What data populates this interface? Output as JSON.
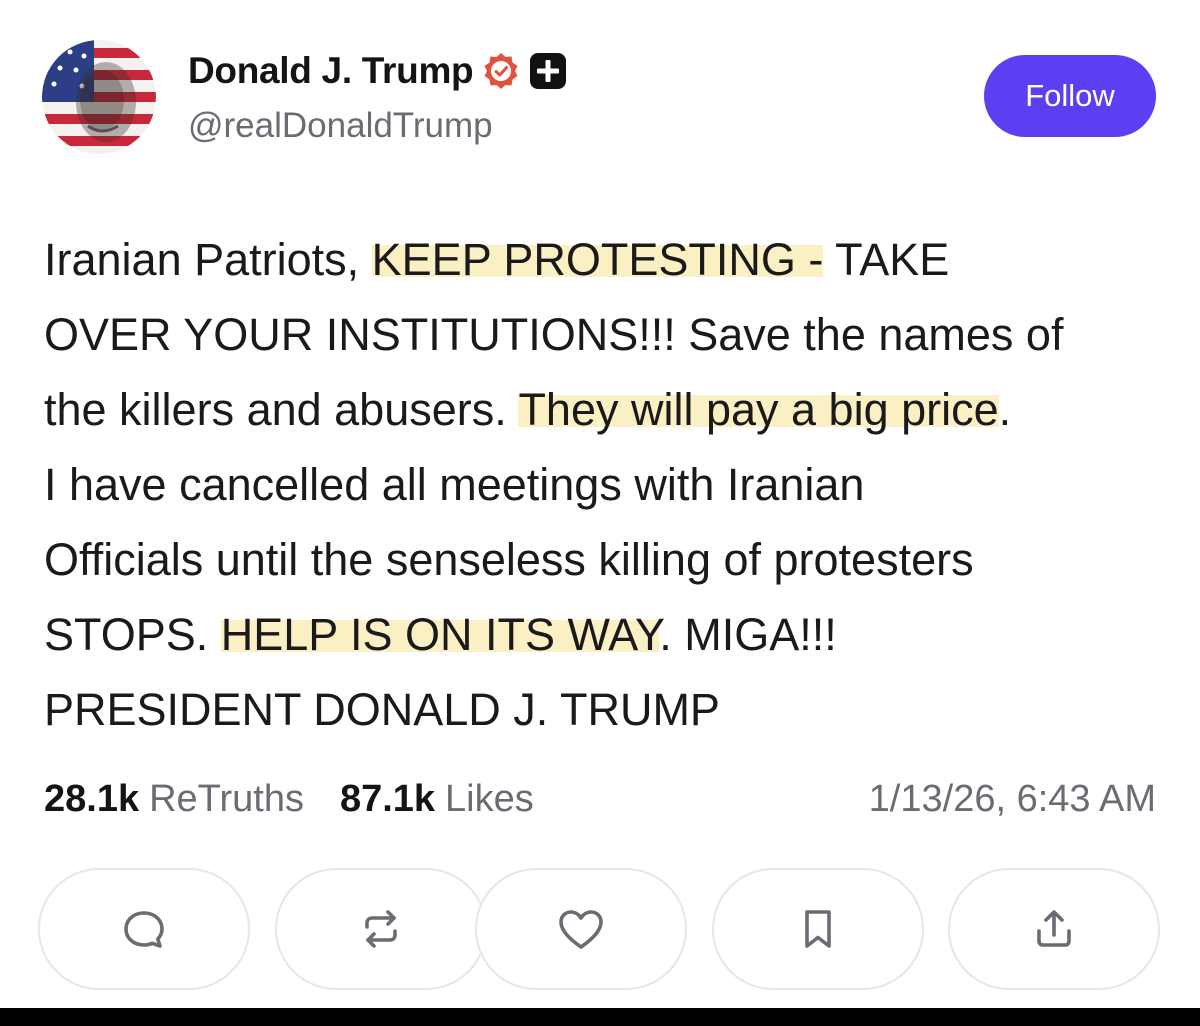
{
  "author": {
    "display_name": "Donald J. Trump",
    "handle": "@realDonaldTrump",
    "avatar_icon": "flag-portrait-avatar",
    "badge_icons": [
      "verified-badge-icon",
      "plus-badge-icon"
    ]
  },
  "follow_button": {
    "label": "Follow",
    "color": "#5b3ff2"
  },
  "post": {
    "highlight_color": "#fbefc4",
    "lines": [
      {
        "pre": "Iranian Patriots, ",
        "hl": "KEEP PROTESTING -",
        "post": " TAKE"
      },
      {
        "pre": "OVER YOUR INSTITUTIONS!!! Save the names of",
        "hl": "",
        "post": ""
      },
      {
        "pre": "the killers and abusers. ",
        "hl": "They will pay a big price",
        "post": "."
      },
      {
        "pre": "I have cancelled all meetings with Iranian",
        "hl": "",
        "post": ""
      },
      {
        "pre": "Officials until the senseless killing of protesters",
        "hl": "",
        "post": ""
      },
      {
        "pre": "STOPS. ",
        "hl": "HELP IS ON ITS WAY",
        "post": ". MIGA!!!"
      },
      {
        "pre": "PRESIDENT DONALD J. TRUMP",
        "hl": "",
        "post": ""
      }
    ]
  },
  "stats": {
    "retruths_count": "28.1k",
    "retruths_label": "ReTruths",
    "likes_count": "87.1k",
    "likes_label": "Likes",
    "timestamp": "1/13/26, 6:43 AM"
  },
  "actions": [
    {
      "name": "reply",
      "icon": "comment-icon"
    },
    {
      "name": "retruth",
      "icon": "repost-icon"
    },
    {
      "name": "like",
      "icon": "heart-icon"
    },
    {
      "name": "bookmark",
      "icon": "bookmark-icon"
    },
    {
      "name": "share",
      "icon": "share-icon"
    }
  ]
}
